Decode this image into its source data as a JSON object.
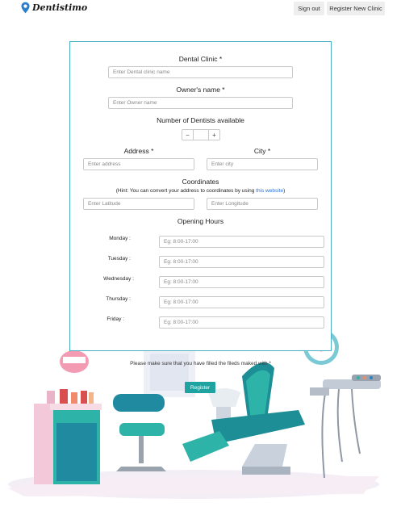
{
  "nav": {
    "brand": "Dentistimo",
    "signout": "Sign out",
    "register_clinic": "Register New Clinic"
  },
  "form": {
    "clinic_label": "Dental Clinic *",
    "clinic_placeholder": "Enter Dental clinic name",
    "owner_label": "Owner's name *",
    "owner_placeholder": "Enter Owner name",
    "dentists_label": "Number of Dentists available",
    "minus": "−",
    "plus": "+",
    "address_label": "Address *",
    "address_placeholder": "Enter address",
    "city_label": "City *",
    "city_placeholder": "Enter city",
    "coords_label": "Coordinates",
    "hint_prefix": "(Hint: You can convert your address to coordinates by using ",
    "hint_link": "this website",
    "hint_suffix": ")",
    "lat_placeholder": "Enter Latitude",
    "lng_placeholder": "Enter Longitude",
    "hours_label": "Opening Hours",
    "days": [
      {
        "label": "Monday :",
        "placeholder": "Eg: 8:00-17:00"
      },
      {
        "label": "Tuesday :",
        "placeholder": "Eg: 8:00-17:00"
      },
      {
        "label": "Wednesday :",
        "placeholder": "Eg: 8:00-17:00"
      },
      {
        "label": "Thursday :",
        "placeholder": "Eg: 8:00-17:00"
      },
      {
        "label": "Friday :",
        "placeholder": "Eg: 8:00-17:00"
      }
    ]
  },
  "notice": "Please make sure that you have filled the fileds maked with *",
  "register_button": "Register",
  "colors": {
    "accent": "#1fa3a0",
    "card_border": "#4ab0c6",
    "link": "#2a6fd6"
  }
}
